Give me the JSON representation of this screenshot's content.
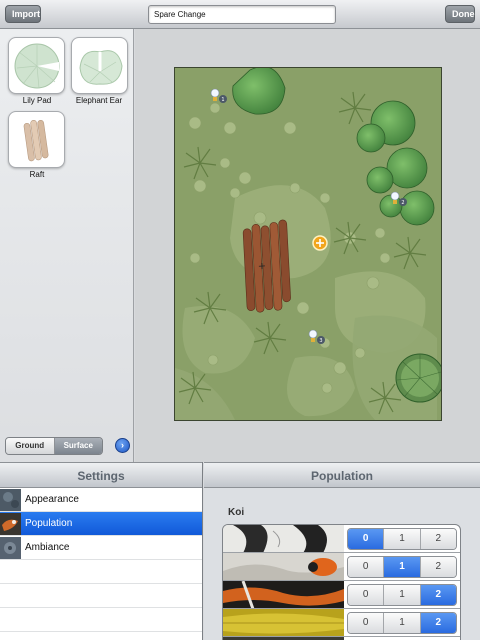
{
  "toolbar": {
    "import_label": "Import",
    "title_value": "Spare Change",
    "done_label": "Done"
  },
  "palette": {
    "items": [
      {
        "label": "Lily Pad",
        "icon": "lily-pad-icon"
      },
      {
        "label": "Elephant Ear",
        "icon": "elephant-ear-icon"
      },
      {
        "label": "Raft",
        "icon": "raft-icon"
      }
    ],
    "segment": {
      "options": [
        "Ground",
        "Surface"
      ],
      "selected": "Surface"
    },
    "next_icon": "arrow-right-icon"
  },
  "settings": {
    "title": "Settings",
    "items": [
      {
        "label": "Appearance",
        "selected": false
      },
      {
        "label": "Population",
        "selected": true
      },
      {
        "label": "Ambiance",
        "selected": false
      }
    ]
  },
  "population": {
    "title": "Population",
    "section": "Koi",
    "rows": [
      {
        "options": [
          "0",
          "1",
          "2"
        ],
        "selected": "0"
      },
      {
        "options": [
          "0",
          "1",
          "2"
        ],
        "selected": "1"
      },
      {
        "options": [
          "0",
          "1",
          "2"
        ],
        "selected": "2"
      },
      {
        "options": [
          "0",
          "1",
          "2"
        ],
        "selected": "2"
      }
    ]
  },
  "colors": {
    "accent": "#1e64e0",
    "pond": "#8fa46b"
  }
}
